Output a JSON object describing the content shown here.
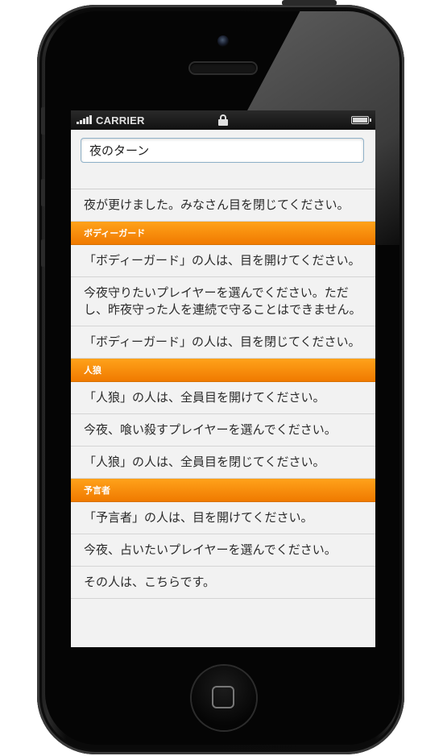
{
  "status_bar": {
    "carrier": "CARRIER"
  },
  "search": {
    "value": "夜のターン"
  },
  "items": [
    {
      "type": "row",
      "text": "夜が更けました。みなさん目を閉じてください。"
    },
    {
      "type": "divider",
      "text": "ボディーガード"
    },
    {
      "type": "row",
      "text": "「ボディーガード」の人は、目を開けてください。"
    },
    {
      "type": "row",
      "text": "今夜守りたいプレイヤーを選んでください。ただし、昨夜守った人を連続で守ることはできません。"
    },
    {
      "type": "row",
      "text": "「ボディーガード」の人は、目を閉じてください。"
    },
    {
      "type": "divider",
      "text": "人狼"
    },
    {
      "type": "row",
      "text": "「人狼」の人は、全員目を開けてください。"
    },
    {
      "type": "row",
      "text": "今夜、喰い殺すプレイヤーを選んでください。"
    },
    {
      "type": "row",
      "text": "「人狼」の人は、全員目を閉じてください。"
    },
    {
      "type": "divider",
      "text": "予言者"
    },
    {
      "type": "row",
      "text": "「予言者」の人は、目を開けてください。"
    },
    {
      "type": "row",
      "text": "今夜、占いたいプレイヤーを選んでください。"
    },
    {
      "type": "row",
      "text": "その人は、こちらです。"
    }
  ],
  "colors": {
    "divider": "#f58a00",
    "background": "#f2f2f2"
  }
}
